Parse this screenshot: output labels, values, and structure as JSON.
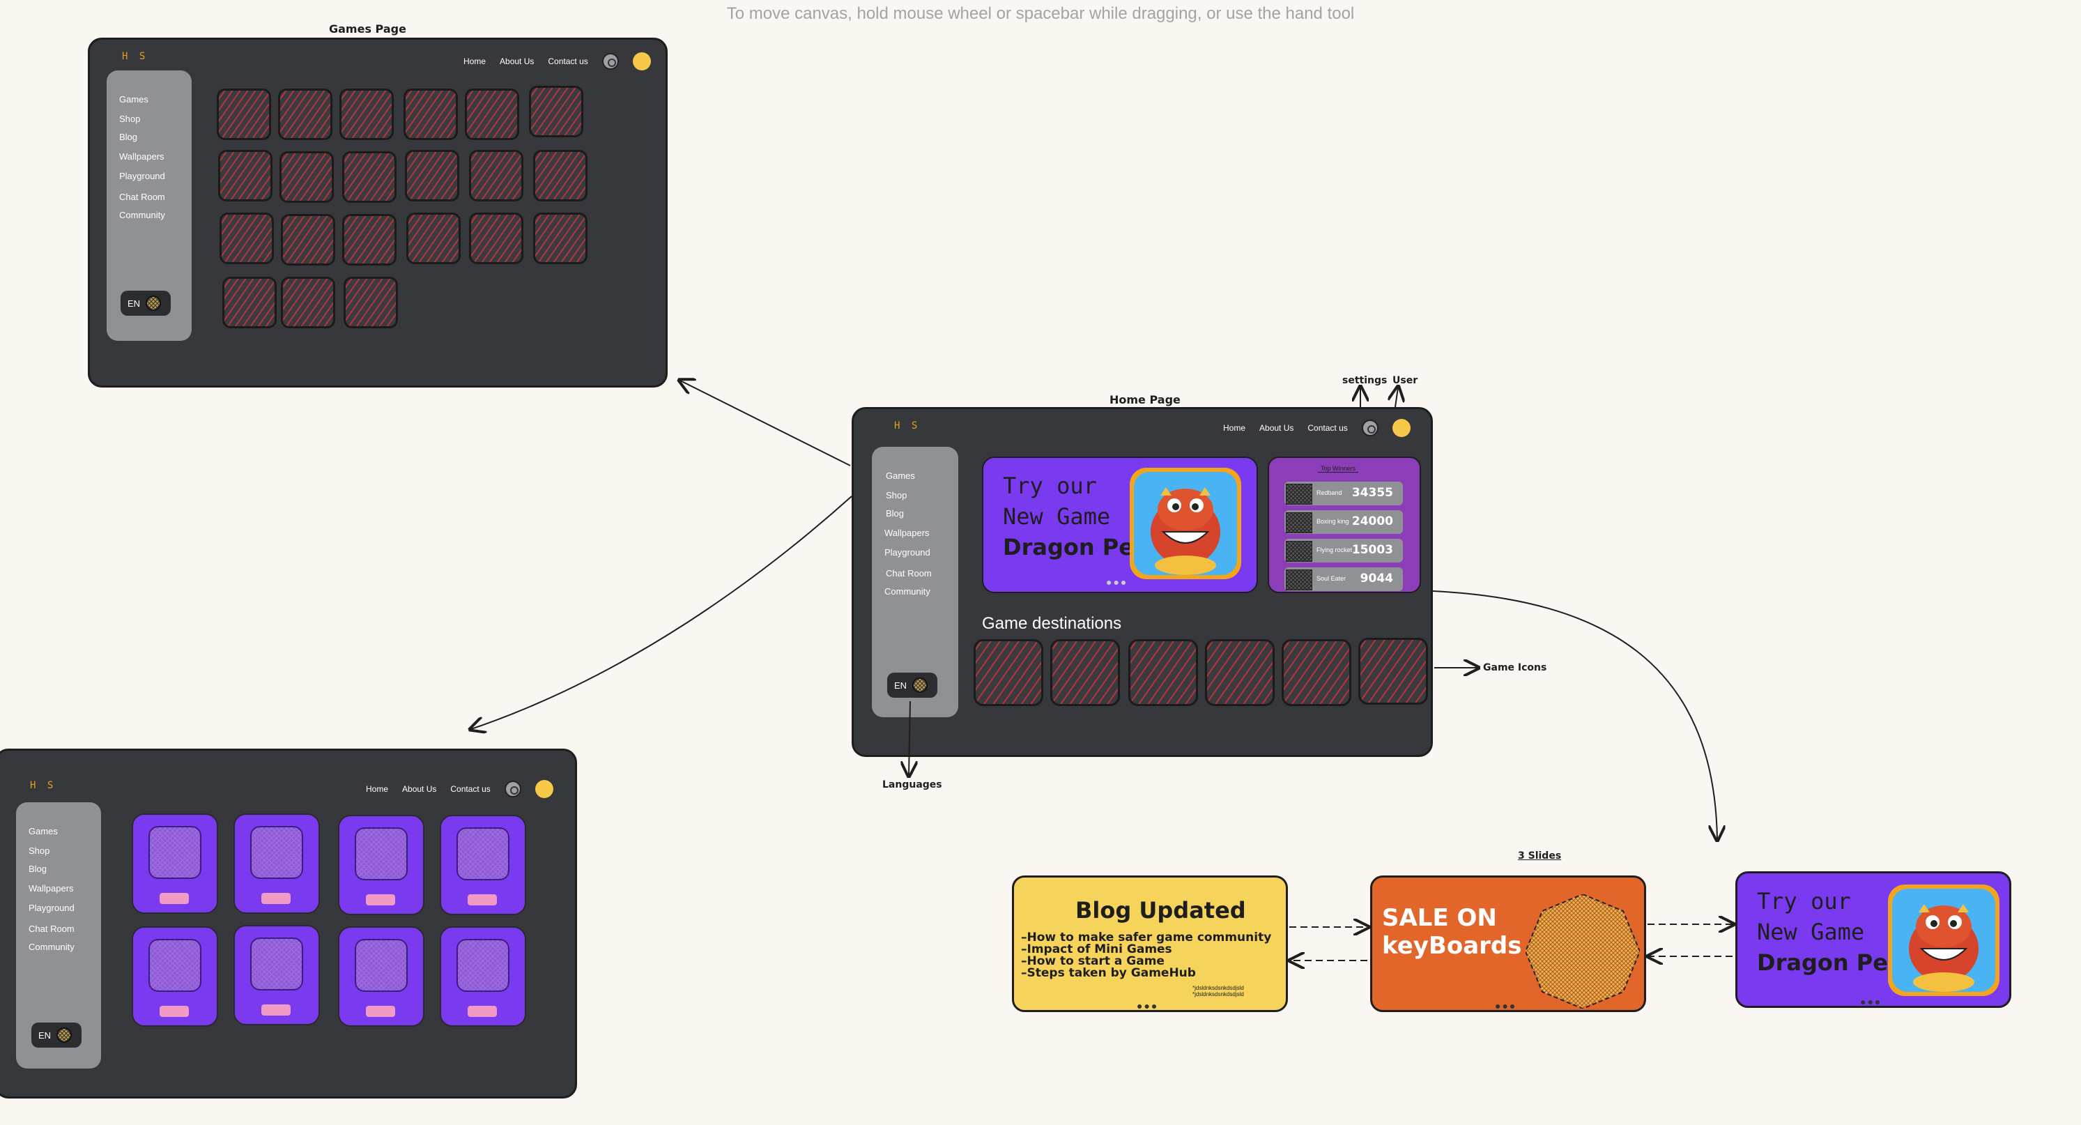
{
  "canvas_hint": "To move canvas, hold mouse wheel or spacebar while dragging, or use the hand tool",
  "logo": "H S",
  "nav": [
    "Home",
    "About Us",
    "Contact us"
  ],
  "sidebar": [
    "Games",
    "Shop",
    "Blog",
    "Wallpapers",
    "Playground",
    "Chat Room",
    "Community"
  ],
  "lang": "EN",
  "games_page": {
    "title": "Games Page"
  },
  "home_page": {
    "title": "Home Page",
    "hero": {
      "line1": "Try our",
      "line2": "New Game",
      "line3": "Dragon Pet",
      "dots": "●●●"
    },
    "winners": {
      "title": "Top Winners",
      "rows": [
        {
          "name": "Redband",
          "score": "34355"
        },
        {
          "name": "Boxing king",
          "score": "24000"
        },
        {
          "name": "Flying rocket",
          "score": "15003"
        },
        {
          "name": "Soul Eater",
          "score": "9044"
        }
      ]
    },
    "destinations_title": "Game destinations"
  },
  "annotations": {
    "settings": "settings",
    "user": "User",
    "game_icons": "Game Icons",
    "languages": "Languages",
    "slides": "3 Slides"
  },
  "slides": {
    "blog": {
      "title": "Blog Updated",
      "items": [
        "–How to make safer game community",
        "–Impact of Mini Games",
        "–How to start a Game",
        "–Steps taken by GameHub"
      ],
      "small1": "*jdsldnksdsnkdsdjsld",
      "small2": "*jdsldnksdsnkdsdjsld"
    },
    "sale": {
      "line1": "SALE ON",
      "line2": "keyBoards"
    },
    "game": {
      "line1": "Try our",
      "line2": "New Game",
      "line3": "Dragon Pet"
    },
    "dots": "●●●"
  },
  "colors": {
    "frame": "#37383b",
    "purple": "#7a3bf0",
    "orange": "#e2652a",
    "yellow": "#f6d35a"
  }
}
